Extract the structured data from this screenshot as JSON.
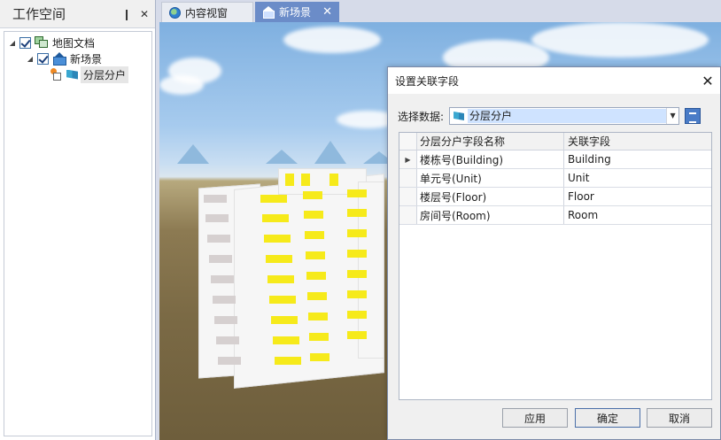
{
  "workspace": {
    "title": "工作空间",
    "tree": {
      "root": "地图文档",
      "scene": "新场景",
      "layer": "分层分户"
    }
  },
  "tabs": [
    {
      "label": "内容视窗",
      "active": false
    },
    {
      "label": "新场景",
      "active": true
    }
  ],
  "dialog": {
    "title": "设置关联字段",
    "select_label": "选择数据:",
    "select_value": "分层分户",
    "columns": [
      "分层分户字段名称",
      "关联字段"
    ],
    "rows": [
      {
        "field": "楼栋号(Building)",
        "link": "Building"
      },
      {
        "field": "单元号(Unit)",
        "link": "Unit"
      },
      {
        "field": "楼层号(Floor)",
        "link": "Floor"
      },
      {
        "field": "房间号(Room)",
        "link": "Room"
      }
    ],
    "buttons": {
      "apply": "应用",
      "ok": "确定",
      "cancel": "取消"
    }
  },
  "colors": {
    "tab_active": "#6b8cc8",
    "window_yellow": "#f6ea1a",
    "selection": "#cfe3ff"
  }
}
